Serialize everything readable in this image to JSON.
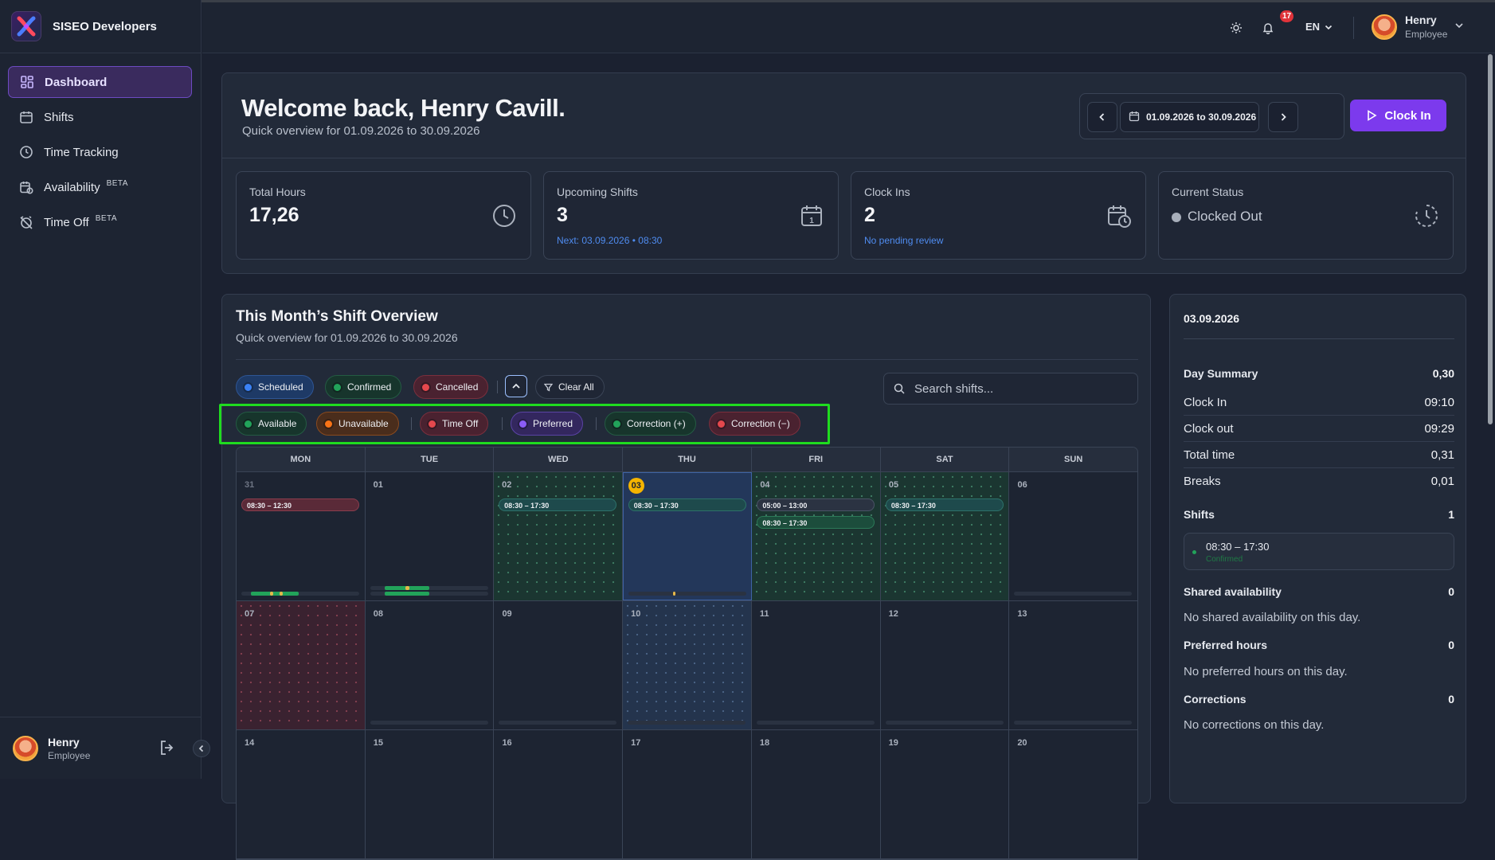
{
  "brand": {
    "name": "SISEO Developers"
  },
  "nav": {
    "items": [
      {
        "label": "Dashboard",
        "badge": ""
      },
      {
        "label": "Shifts",
        "badge": ""
      },
      {
        "label": "Time Tracking",
        "badge": ""
      },
      {
        "label": "Availability",
        "badge": "BETA"
      },
      {
        "label": "Time Off",
        "badge": "BETA"
      }
    ]
  },
  "sidebar_user": {
    "name": "Henry",
    "role": "Employee"
  },
  "header": {
    "notifications": "17",
    "language": "EN",
    "user_name": "Henry",
    "user_role": "Employee"
  },
  "welcome": {
    "title": "Welcome back, Henry Cavill.",
    "subtitle": "Quick overview for 01.09.2026 to 30.09.2026",
    "range": "01.09.2026 to 30.09.2026",
    "clock_in_label": "Clock In"
  },
  "stats": {
    "total_hours": {
      "label": "Total Hours",
      "value": "17,26"
    },
    "upcoming": {
      "label": "Upcoming Shifts",
      "value": "3",
      "note": "Next: 03.09.2026 • 08:30"
    },
    "clock_ins": {
      "label": "Clock Ins",
      "value": "2",
      "note": "No pending review"
    },
    "status": {
      "label": "Current Status",
      "value": "Clocked Out"
    }
  },
  "overview": {
    "title": "This Month’s Shift Overview",
    "subtitle": "Quick overview for 01.09.2026 to 30.09.2026",
    "filters_row1": {
      "scheduled": "Scheduled",
      "confirmed": "Confirmed",
      "cancelled": "Cancelled",
      "clear": "Clear All"
    },
    "filters_row2": {
      "available": "Available",
      "unavailable": "Unavailable",
      "time_off": "Time Off",
      "preferred": "Preferred",
      "corr_plus": "Correction (+)",
      "corr_minus": "Correction (−)"
    },
    "search_placeholder": "Search shifts...",
    "weekdays": [
      "MON",
      "TUE",
      "WED",
      "THU",
      "FRI",
      "SAT",
      "SUN"
    ],
    "weeks": [
      [
        "31",
        "01",
        "02",
        "03",
        "04",
        "05",
        "06"
      ],
      [
        "07",
        "08",
        "09",
        "10",
        "11",
        "12",
        "13"
      ],
      [
        "14",
        "15",
        "16",
        "17",
        "18",
        "19",
        "20"
      ]
    ],
    "shifts": {
      "mon31": "08:30 – 12:30",
      "wed02": "08:30 – 17:30",
      "thu03": "08:30 – 17:30",
      "fri04_a": "05:00 – 13:00",
      "fri04_b": "08:30 – 17:30",
      "sat05": "08:30 – 17:30"
    }
  },
  "day_panel": {
    "date": "03.09.2026",
    "summary_label": "Day Summary",
    "summary_value": "0,30",
    "clock_in_label": "Clock In",
    "clock_in_value": "09:10",
    "clock_out_label": "Clock out",
    "clock_out_value": "09:29",
    "total_label": "Total time",
    "total_value": "0,31",
    "breaks_label": "Breaks",
    "breaks_value": "0,01",
    "shifts_label": "Shifts",
    "shifts_value": "1",
    "shift_time": "08:30 – 17:30",
    "shift_status": "Confirmed",
    "shared_label": "Shared availability",
    "shared_value": "0",
    "shared_empty": "No shared availability on this day.",
    "preferred_label": "Preferred hours",
    "preferred_value": "0",
    "preferred_empty": "No preferred hours on this day.",
    "corrections_label": "Corrections",
    "corrections_value": "0",
    "corrections_empty": "No corrections on this day."
  },
  "colors": {
    "accent": "#7c3aed",
    "highlight": "#1fdc1f"
  }
}
